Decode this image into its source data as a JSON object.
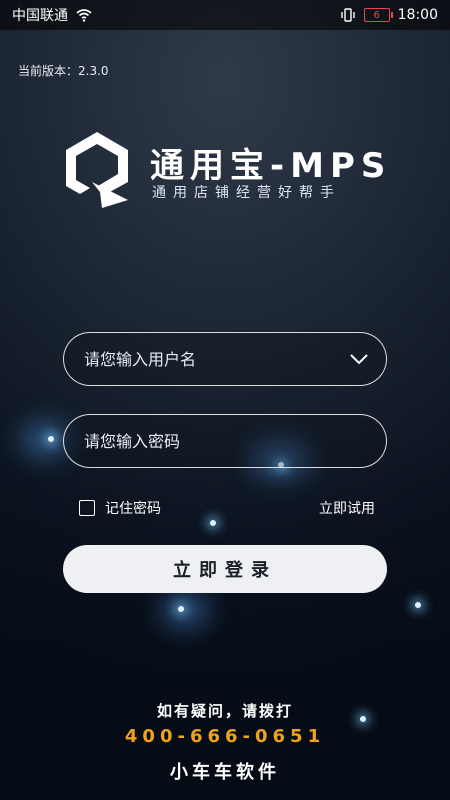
{
  "status_bar": {
    "carrier": "中国联通",
    "time": "18:00",
    "battery_level": "6"
  },
  "app": {
    "version": "当前版本：2.3.0",
    "brand_title": "通用宝-MPS",
    "brand_subtitle": "通用店铺经营好帮手"
  },
  "form": {
    "username_placeholder": "请您输入用户名",
    "password_placeholder": "请您输入密码",
    "remember_label": "记住密码",
    "trial_label": "立即试用",
    "login_label": "立即登录"
  },
  "help": {
    "question": "如有疑问，请拨打",
    "phone": "400-666-0651",
    "company": "小车车软件"
  },
  "colors": {
    "accent_phone": "#f0a21a",
    "button_bg": "#eef0f3"
  },
  "icons": {
    "wifi": "wifi-icon",
    "vibrate": "vibrate-icon",
    "battery": "battery-icon",
    "dropdown": "chevron-down-icon",
    "logo": "brand-logo-icon"
  }
}
